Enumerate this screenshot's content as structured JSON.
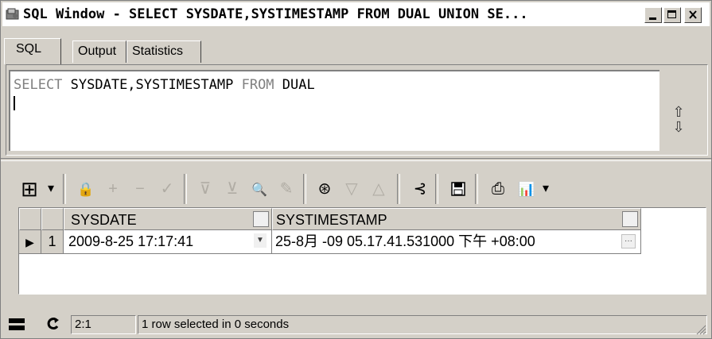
{
  "window": {
    "title": "SQL Window - SELECT SYSDATE,SYSTIMESTAMP FROM DUAL UNION SE...",
    "minimize_label": "_",
    "maximize_label": "□",
    "close_label": "×"
  },
  "tabs": [
    {
      "label": "SQL",
      "active": true
    },
    {
      "label": "Output",
      "active": false
    },
    {
      "label": "Statistics",
      "active": false
    }
  ],
  "editor": {
    "kw_select": "SELECT",
    "columns": " SYSDATE,SYSTIMESTAMP ",
    "kw_from": "FROM",
    "table": " DUAL",
    "scroll_up_icon": "⇧",
    "scroll_down_icon": "⇩"
  },
  "toolbar": {
    "icons": [
      "grid-icon",
      "lock-icon",
      "plus-icon",
      "minus-icon",
      "check-icon",
      "filter-down-icon",
      "filter-clear-icon",
      "find-icon",
      "eraser-icon",
      "query-by-example-icon",
      "triangle-down-icon",
      "triangle-up-icon",
      "connect-icon",
      "save-icon",
      "print-icon",
      "chart-icon"
    ],
    "glyphs": {
      "grid": "⊞",
      "dropdown": "▾",
      "lock": "🔒",
      "plus": "+",
      "minus": "−",
      "check": "✓",
      "filter1": "⊽",
      "filter2": "⊻",
      "find": "🔍",
      "eraser": "✎",
      "qbe": "⊛",
      "tri_down": "▽",
      "tri_up": "△",
      "connect": "⊰",
      "save": "🖫",
      "print": "⎙",
      "chart": "📊"
    }
  },
  "grid": {
    "columns": [
      "SYSDATE",
      "SYSTIMESTAMP"
    ],
    "rows": [
      {
        "row_number": "1",
        "sysdate": "2009-8-25 17:17:41",
        "systimestamp": "25-8月 -09 05.17.41.531000 下午 +08:00"
      }
    ],
    "row_indicator": "▶",
    "cell_dropdown": "▼",
    "cell_ellipsis": "···"
  },
  "status": {
    "position": "2:1",
    "message": "1 row selected in 0 seconds"
  }
}
